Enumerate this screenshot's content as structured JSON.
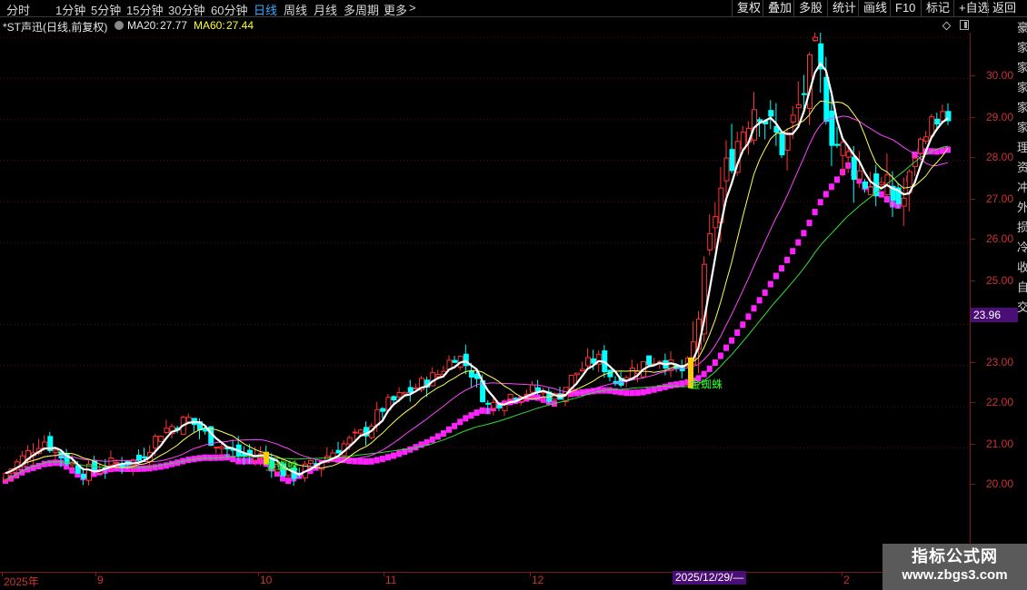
{
  "toolbar": {
    "periods": [
      {
        "label": "分时",
        "active": false
      },
      {
        "label": "1分钟",
        "active": false
      },
      {
        "label": "5分钟",
        "active": false
      },
      {
        "label": "15分钟",
        "active": false
      },
      {
        "label": "30分钟",
        "active": false
      },
      {
        "label": "60分钟",
        "active": false
      },
      {
        "label": "日线",
        "active": true
      },
      {
        "label": "周线",
        "active": false
      },
      {
        "label": "月线",
        "active": false
      },
      {
        "label": "多周期",
        "active": false
      },
      {
        "label": "更多",
        "active": false
      }
    ],
    "more_chevron": ">",
    "functions": [
      "复权",
      "叠加",
      "多股",
      "统计",
      "画线",
      "F10",
      "标记",
      "+自选",
      "返回"
    ]
  },
  "info": {
    "stock_title": "*ST声迅(日线,前复权)",
    "ma20_label": "MA20:",
    "ma20_value": "27.77",
    "ma60_label": "MA60:",
    "ma60_value": "27.44",
    "ma20_color": "#e8e8e8",
    "ma60_color": "#ffff33"
  },
  "price_axis": {
    "ticks": [
      "30.00",
      "29.00",
      "28.00",
      "27.00",
      "26.00",
      "25.00",
      "23.00",
      "22.00",
      "21.00",
      "20.00"
    ],
    "current_price": "23.96"
  },
  "side_strip_chars": [
    "豪",
    "家",
    "家",
    "家",
    "家",
    "家",
    "理",
    "资",
    "冲",
    "外",
    "损",
    "冷",
    "收",
    "自",
    "交"
  ],
  "date_axis": {
    "labels": [
      "2025年",
      "9",
      "10",
      "11",
      "12",
      "2"
    ],
    "cursor_label": "2025/12/29/—"
  },
  "signals": [
    {
      "label": "金蜘蛛",
      "color": "#33ff33"
    },
    {
      "label": "金蜘蛛",
      "color": "#33ff33"
    }
  ],
  "watermark": {
    "title": "指标公式网",
    "url": "www.zbgs3.com"
  },
  "colors": {
    "up": "#ff3333",
    "down": "#00ffff",
    "ma_white": "#ffffff",
    "ma_yellow": "#ffff55",
    "ma_magenta": "#ff44ff",
    "ma_green": "#33dd33",
    "band": "#ff22ff",
    "signal_bar": "#ffcc00"
  },
  "chart_data": {
    "type": "candlestick",
    "price_ticks": [
      30,
      29,
      28,
      27,
      26,
      25,
      23,
      22,
      21,
      20
    ]
  }
}
